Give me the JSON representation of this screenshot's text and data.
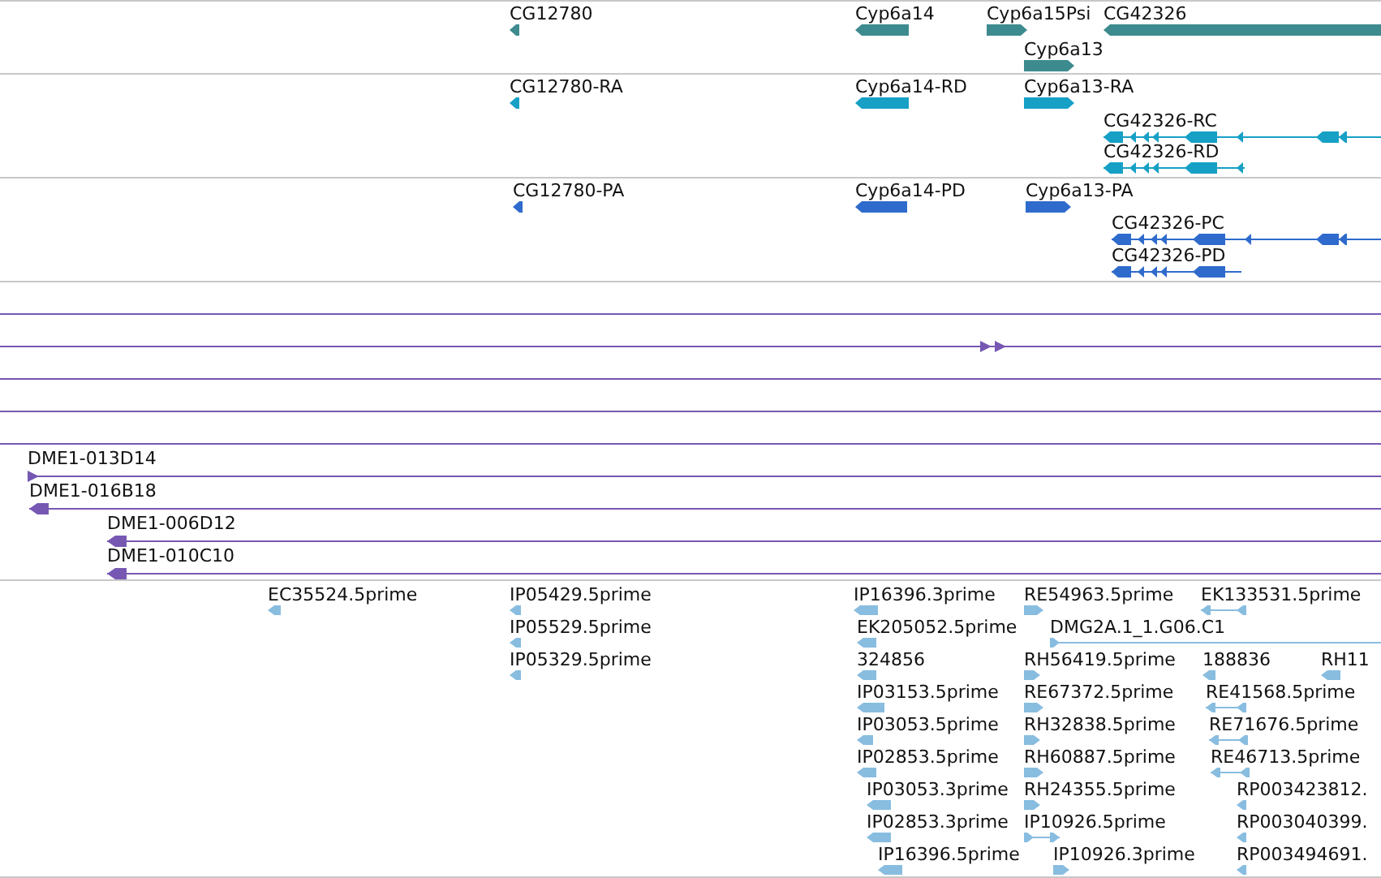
{
  "tracks": [
    {
      "kind": "gene",
      "color": "#3d8b8f",
      "features": [
        {
          "label": "CG12780",
          "reverse": true
        },
        {
          "label": "Cyp6a14",
          "reverse": true
        },
        {
          "label": "Cyp6a15Psi",
          "reverse": false
        },
        {
          "label": "CG42326",
          "reverse": true
        },
        {
          "label": "Cyp6a13",
          "reverse": false
        }
      ]
    },
    {
      "kind": "transcript",
      "color": "#16a0c6",
      "features": [
        {
          "label": "CG12780-RA",
          "reverse": true
        },
        {
          "label": "Cyp6a14-RD",
          "reverse": true
        },
        {
          "label": "Cyp6a13-RA",
          "reverse": false
        },
        {
          "label": "CG42326-RC",
          "reverse": true
        },
        {
          "label": "CG42326-RD",
          "reverse": true
        }
      ]
    },
    {
      "kind": "transcript",
      "color": "#2f6bcc",
      "features": [
        {
          "label": "CG12780-PA",
          "reverse": true
        },
        {
          "label": "Cyp6a14-PD",
          "reverse": true
        },
        {
          "label": "Cyp6a13-PA",
          "reverse": false
        },
        {
          "label": "CG42326-PC",
          "reverse": true
        },
        {
          "label": "CG42326-PD",
          "reverse": true
        }
      ]
    },
    {
      "kind": "alignment",
      "color": "#7658b3",
      "features": [
        {
          "arrow": false
        },
        {
          "arrow": true,
          "reverse": false
        },
        {
          "arrow": false
        },
        {
          "arrow": false
        },
        {
          "arrow": false
        },
        {
          "label": "DME1-013D14",
          "arrow": true,
          "reverse": false
        },
        {
          "label": "DME1-016B18",
          "arrow": true,
          "reverse": true
        },
        {
          "label": "DME1-006D12",
          "arrow": true,
          "reverse": true
        },
        {
          "label": "DME1-010C10",
          "arrow": true,
          "reverse": true
        }
      ]
    },
    {
      "kind": "est",
      "color": "#88bde0",
      "features": [
        {
          "label": "EC35524.5prime",
          "reverse": true
        },
        {
          "label": "IP05429.5prime",
          "reverse": true
        },
        {
          "label": "IP16396.3prime",
          "reverse": true
        },
        {
          "label": "RE54963.5prime",
          "reverse": false
        },
        {
          "label": "EK133531.5prime",
          "reverse": true
        },
        {
          "label": "IP05529.5prime",
          "reverse": true
        },
        {
          "label": "EK205052.5prime",
          "reverse": true
        },
        {
          "label": "DMG2A.1_1.G06.C1",
          "reverse": false
        },
        {
          "label": "IP05329.5prime",
          "reverse": true
        },
        {
          "label": "324856",
          "reverse": true
        },
        {
          "label": "RH56419.5prime",
          "reverse": false
        },
        {
          "label": "188836",
          "reverse": true
        },
        {
          "label": "RH11",
          "reverse": true
        },
        {
          "label": "IP03153.5prime",
          "reverse": true
        },
        {
          "label": "RE67372.5prime",
          "reverse": false
        },
        {
          "label": "RE41568.5prime",
          "reverse": true
        },
        {
          "label": "IP03053.5prime",
          "reverse": true
        },
        {
          "label": "RH32838.5prime",
          "reverse": false
        },
        {
          "label": "RE71676.5prime",
          "reverse": true
        },
        {
          "label": "IP02853.5prime",
          "reverse": true
        },
        {
          "label": "RH60887.5prime",
          "reverse": false
        },
        {
          "label": "RE46713.5prime",
          "reverse": true
        },
        {
          "label": "IP03053.3prime",
          "reverse": true
        },
        {
          "label": "RH24355.5prime",
          "reverse": false
        },
        {
          "label": "RP003423812.",
          "reverse": true
        },
        {
          "label": "IP02853.3prime",
          "reverse": true
        },
        {
          "label": "IP10926.5prime",
          "reverse": false
        },
        {
          "label": "RP003040399.",
          "reverse": true
        },
        {
          "label": "IP16396.5prime",
          "reverse": true
        },
        {
          "label": "IP10926.3prime",
          "reverse": false
        },
        {
          "label": "RP003494691.",
          "reverse": true
        }
      ]
    }
  ]
}
